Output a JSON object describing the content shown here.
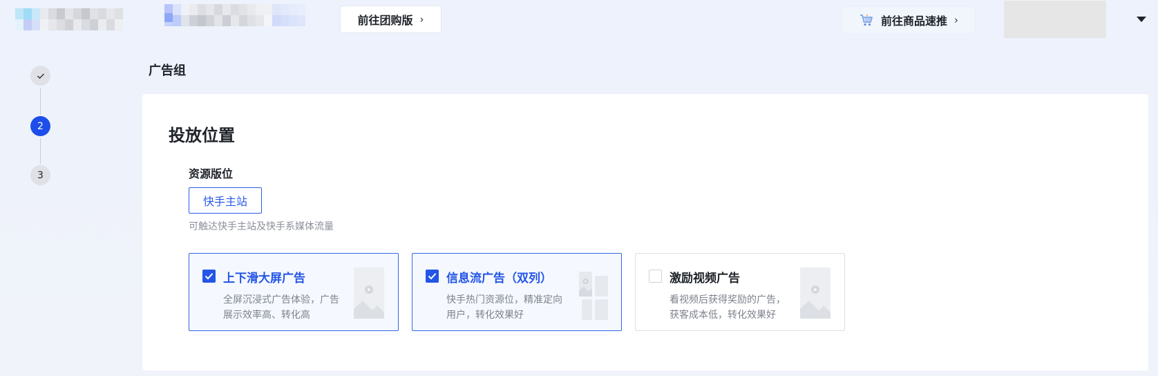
{
  "header": {
    "tuangou_button": "前往团购版",
    "sutui_button": "前往商品速推"
  },
  "steps": [
    "✓",
    "2",
    "3"
  ],
  "section_title": "广告组",
  "card": {
    "title": "投放位置",
    "resource_label": "资源版位",
    "source_tag": "快手主站",
    "source_desc": "可触达快手主站及快手系媒体流量",
    "options": [
      {
        "title": "上下滑大屏广告",
        "desc": "全屏沉浸式广告体验，广告展示效率高、转化高",
        "checked": true
      },
      {
        "title": "信息流广告（双列）",
        "desc": "快手热门资源位，精准定向用户，转化效果好",
        "checked": true
      },
      {
        "title": "激励视频广告",
        "desc": "看视频后获得奖励的广告，获客成本低，转化效果好",
        "checked": false
      }
    ]
  },
  "colors": {
    "accent": "#2355e6",
    "step_active": "#1d4ee9"
  }
}
